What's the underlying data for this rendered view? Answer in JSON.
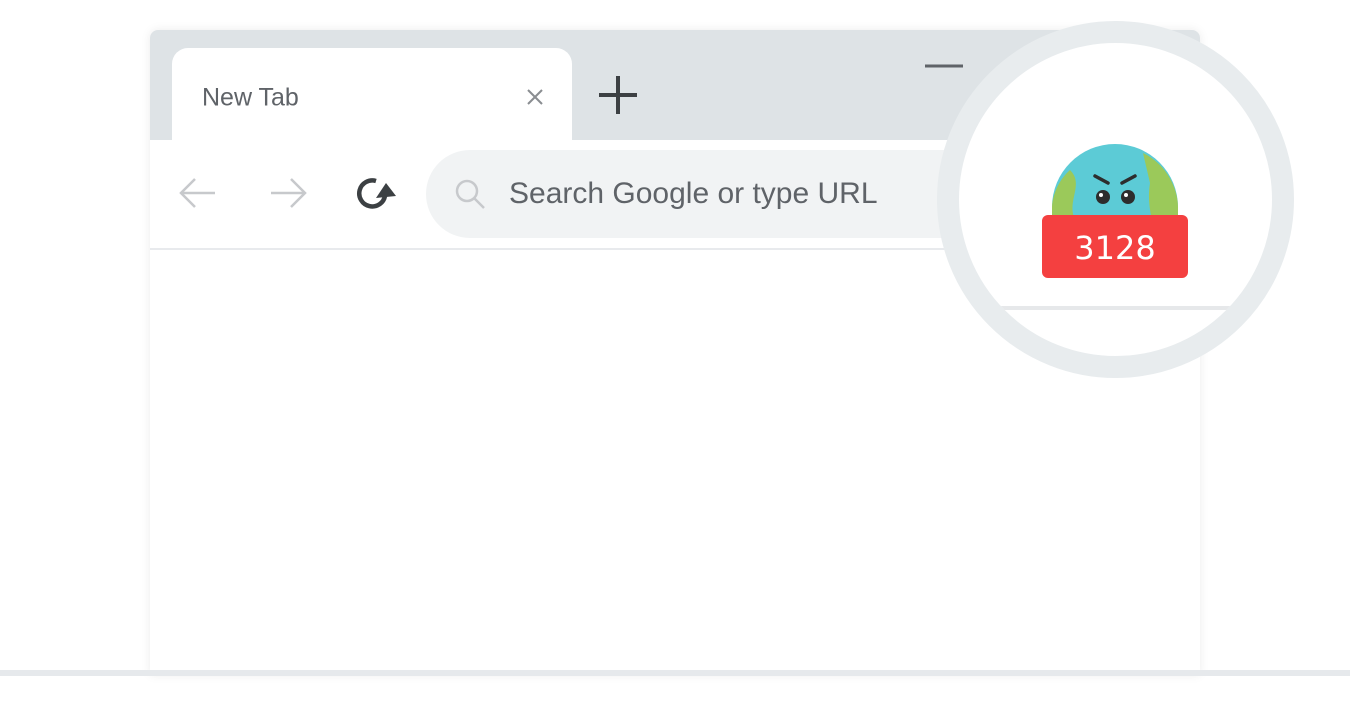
{
  "browser": {
    "tab": {
      "title": "New Tab"
    },
    "toolbar": {
      "search_placeholder": "Search Google or type URL"
    }
  },
  "extension": {
    "badge_count": "3128",
    "badge_color": "#f44040"
  },
  "icons": {
    "close": "close-icon",
    "new_tab": "plus-icon",
    "minimize": "minimize-icon",
    "maximize": "maximize-icon",
    "back": "back-arrow-icon",
    "forward": "forward-arrow-icon",
    "reload": "reload-icon",
    "search": "search-icon",
    "menu": "vertical-dots-icon",
    "extension_mascot": "angry-globe-icon"
  },
  "colors": {
    "tabstrip": "#dee3e6",
    "omnibox": "#f1f3f4",
    "mascot_blue": "#5ccbd6",
    "mascot_green": "#9bc95a"
  }
}
